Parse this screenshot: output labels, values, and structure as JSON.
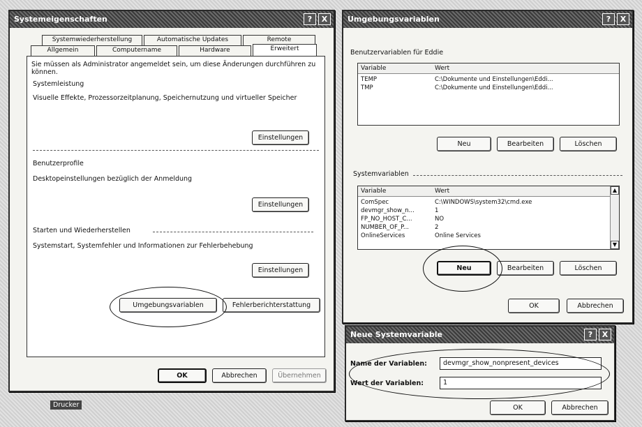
{
  "sysprops": {
    "title": "Systemeigenschaften",
    "title_buttons": [
      "?",
      "X"
    ],
    "tabs_row1": [
      "Systemwiederherstellung",
      "Automatische Updates",
      "Remote"
    ],
    "tabs_row2": [
      "Allgemein",
      "Computername",
      "Hardware",
      "Erweitert"
    ],
    "admin_note": "Sie müssen als Administrator angemeldet sein, um diese Änderungen durchführen zu können.",
    "perf_title": "Systemleistung",
    "perf_desc": "Visuelle Effekte, Prozessorzeitplanung, Speichernutzung und virtueller Speicher",
    "profiles_title": "Benutzerprofile",
    "profiles_desc": "Desktopeinstellungen bezüglich der Anmeldung",
    "startup_title": "Starten und Wiederherstellen",
    "startup_desc": "Systemstart, Systemfehler und Informationen zur Fehlerbehebung",
    "settings_button": "Einstellungen",
    "env_button": "Umgebungsvariablen",
    "error_button": "Fehlerberichterstattung",
    "ok": "OK",
    "cancel": "Abbrechen",
    "apply": "Übernehmen"
  },
  "envvars": {
    "title": "Umgebungsvariablen",
    "title_buttons": [
      "?",
      "X"
    ],
    "user_group": "Benutzervariablen für Eddie",
    "col_var": "Variable",
    "col_val": "Wert",
    "user_rows": [
      {
        "name": "TEMP",
        "value": "C:\\Dokumente und Einstellungen\\Eddi..."
      },
      {
        "name": "TMP",
        "value": "C:\\Dokumente und Einstellungen\\Eddi..."
      }
    ],
    "sys_group": "Systemvariablen",
    "sys_rows": [
      {
        "name": "ComSpec",
        "value": "C:\\WINDOWS\\system32\\cmd.exe"
      },
      {
        "name": "devmgr_show_n...",
        "value": "1"
      },
      {
        "name": "FP_NO_HOST_C...",
        "value": "NO"
      },
      {
        "name": "NUMBER_OF_P...",
        "value": "2"
      },
      {
        "name": "OnlineServices",
        "value": "Online Services"
      }
    ],
    "new": "Neu",
    "edit": "Bearbeiten",
    "delete": "Löschen",
    "ok": "OK",
    "cancel": "Abbrechen"
  },
  "newvar": {
    "title": "Neue Systemvariable",
    "title_buttons": [
      "?",
      "X"
    ],
    "name_label": "Name der Variablen:",
    "name_value": "devmgr_show_nonpresent_devices",
    "value_label": "Wert der Variablen:",
    "value_value": "1",
    "ok": "OK",
    "cancel": "Abbrechen"
  },
  "taskbar": {
    "label": "Drucker"
  }
}
